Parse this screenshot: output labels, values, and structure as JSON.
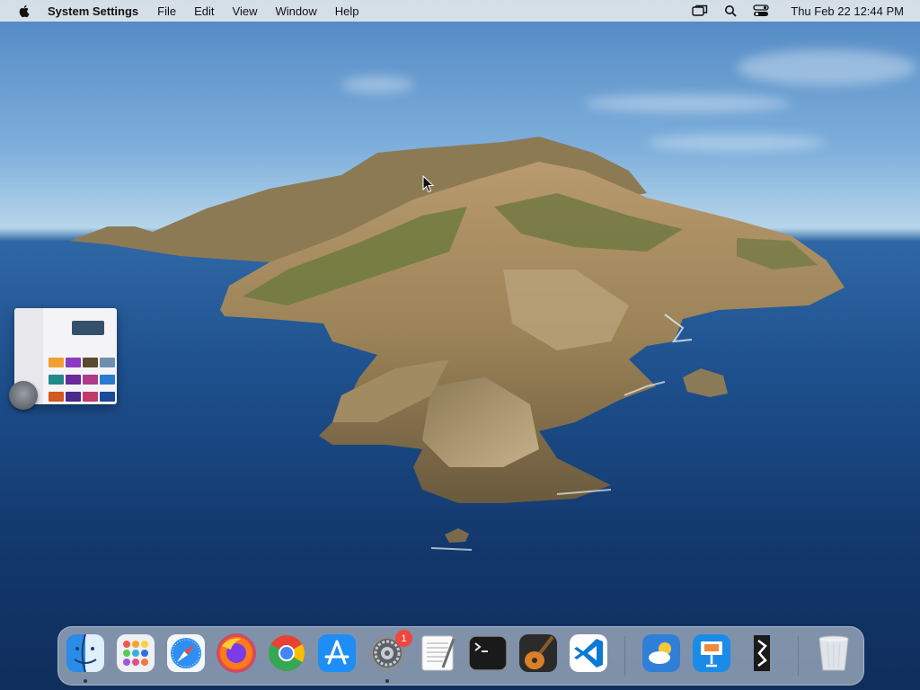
{
  "menubar": {
    "app_name": "System Settings",
    "menus": [
      "File",
      "Edit",
      "View",
      "Window",
      "Help"
    ],
    "clock": "Thu Feb 22  12:44 PM",
    "status_icons": [
      "screen-mirroring-icon",
      "spotlight-search-icon",
      "control-center-icon"
    ]
  },
  "stage_manager": {
    "app": "System Settings"
  },
  "dock": {
    "apps": [
      {
        "name": "Finder",
        "icon": "finder-icon",
        "running": true
      },
      {
        "name": "Launchpad",
        "icon": "launchpad-icon",
        "running": false
      },
      {
        "name": "Safari",
        "icon": "safari-icon",
        "running": false
      },
      {
        "name": "Firefox",
        "icon": "firefox-icon",
        "running": false
      },
      {
        "name": "Google Chrome",
        "icon": "chrome-icon",
        "running": false
      },
      {
        "name": "App Store",
        "icon": "app-store-icon",
        "running": false
      },
      {
        "name": "System Settings",
        "icon": "system-settings-icon",
        "running": true,
        "badge": "1"
      },
      {
        "name": "TextEdit",
        "icon": "textedit-icon",
        "running": false
      },
      {
        "name": "Terminal",
        "icon": "terminal-icon",
        "running": false
      },
      {
        "name": "GarageBand",
        "icon": "garageband-icon",
        "running": false
      },
      {
        "name": "Visual Studio Code",
        "icon": "vscode-icon",
        "running": false
      },
      {
        "name": "Weather",
        "icon": "weather-icon",
        "running": false
      },
      {
        "name": "Keynote",
        "icon": "keynote-icon",
        "running": false
      },
      {
        "name": "BBEdit",
        "icon": "bbedit-icon",
        "running": false
      },
      {
        "name": "Trash",
        "icon": "trash-icon",
        "running": false
      }
    ]
  },
  "colors": {
    "menubar_bg": "#e1e6ec",
    "badge": "#f0463e",
    "sea": "#1d4f8c",
    "sky": "#7fb0dc"
  }
}
